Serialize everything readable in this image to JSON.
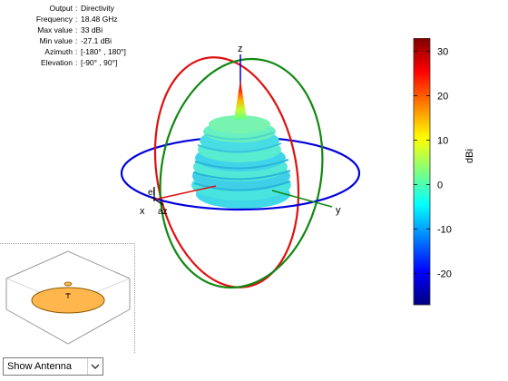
{
  "info": [
    {
      "key": "Output",
      "value": "Directivity"
    },
    {
      "key": "Frequency",
      "value": "18.48 GHz"
    },
    {
      "key": "Max value",
      "value": "33 dBi"
    },
    {
      "key": "Min value",
      "value": "-27.1 dBi"
    },
    {
      "key": "Azimuth",
      "value": "[-180° , 180°]"
    },
    {
      "key": "Elevation",
      "value": "[-90° , 90°]"
    }
  ],
  "axes": {
    "z_label": "z",
    "x_label": "x",
    "y_label": "y",
    "el_label": "el",
    "az_label": "az"
  },
  "colorbar": {
    "unit": "dBi",
    "ticks": [
      "30",
      "20",
      "10",
      "0",
      "-10",
      "-20"
    ],
    "range": [
      -27.1,
      33
    ]
  },
  "controls": {
    "view_select": "Show Antenna"
  },
  "colors": {
    "azimuth_circle": "#0000dd",
    "xz_circle": "#dd1111",
    "yz_circle": "#118811",
    "pattern_base": "#40e0e0"
  }
}
